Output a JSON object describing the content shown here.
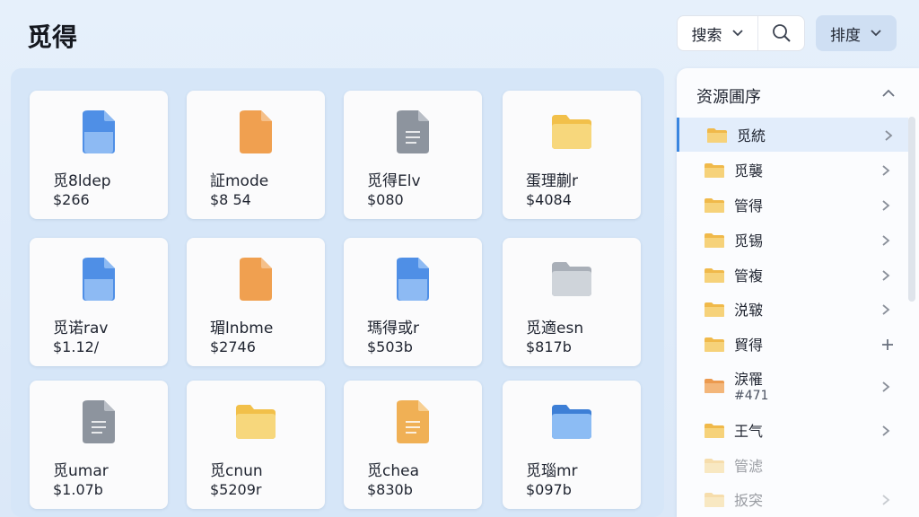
{
  "header": {
    "title": "觅得"
  },
  "search": {
    "dropdown_label": "搜索",
    "icon": "search-icon"
  },
  "sort": {
    "label": "排度"
  },
  "grid": {
    "cards": [
      {
        "name": "觅8ldep",
        "price": "$266",
        "icon": "doc-blue"
      },
      {
        "name": "証mode",
        "price": "$8 54",
        "icon": "doc-orange"
      },
      {
        "name": "觅得Elv",
        "price": "$080",
        "icon": "doc-gray"
      },
      {
        "name": "蛋理蒯r",
        "price": "$4084",
        "icon": "folder-yellow"
      },
      {
        "name": "觅诺rav",
        "price": "$1.12/",
        "icon": "doc-blue"
      },
      {
        "name": "瑂lnbme",
        "price": "$2746",
        "icon": "doc-orange"
      },
      {
        "name": "瑪得或r",
        "price": "$503b",
        "icon": "doc-blue"
      },
      {
        "name": "觅適esn",
        "price": "$817b",
        "icon": "folder-gray"
      },
      {
        "name": "觅umar",
        "price": "$1.07b",
        "icon": "doc-gray"
      },
      {
        "name": "觅cnun",
        "price": "$5209r",
        "icon": "folder-yellow"
      },
      {
        "name": "觅chea",
        "price": "$830b",
        "icon": "doc-orange-lines"
      },
      {
        "name": "觅瑙mr",
        "price": "$097b",
        "icon": "folder-blue"
      }
    ]
  },
  "tree": {
    "title": "资源圃序",
    "items": [
      {
        "label": "觅統",
        "active": true,
        "icon": "folder-yellow",
        "action": "chevron"
      },
      {
        "label": "觅襲",
        "icon": "folder-yellow",
        "action": "chevron"
      },
      {
        "label": "管得",
        "icon": "folder-yellow",
        "action": "chevron"
      },
      {
        "label": "觅锡",
        "icon": "folder-yellow",
        "action": "chevron"
      },
      {
        "label": "管複",
        "icon": "folder-yellow",
        "action": "chevron"
      },
      {
        "label": "涚皲",
        "icon": "folder-yellow",
        "action": "chevron"
      },
      {
        "label": "貿得",
        "icon": "folder-yellow",
        "action": "plus"
      },
      {
        "label": "淚罹",
        "sub": "#471",
        "icon": "folder-orange",
        "action": "chevron"
      },
      {
        "label": "王气",
        "icon": "folder-yellow",
        "action": "chevron"
      },
      {
        "label": "管滤",
        "icon": "folder-yellow",
        "faded": true,
        "action": "none"
      },
      {
        "label": "扳突",
        "icon": "folder-yellow",
        "faded": true,
        "action": "chevron"
      }
    ]
  },
  "colors": {
    "accent": "#3a86e0",
    "panel": "#d6e6f8",
    "background": "#e6f0fb"
  }
}
